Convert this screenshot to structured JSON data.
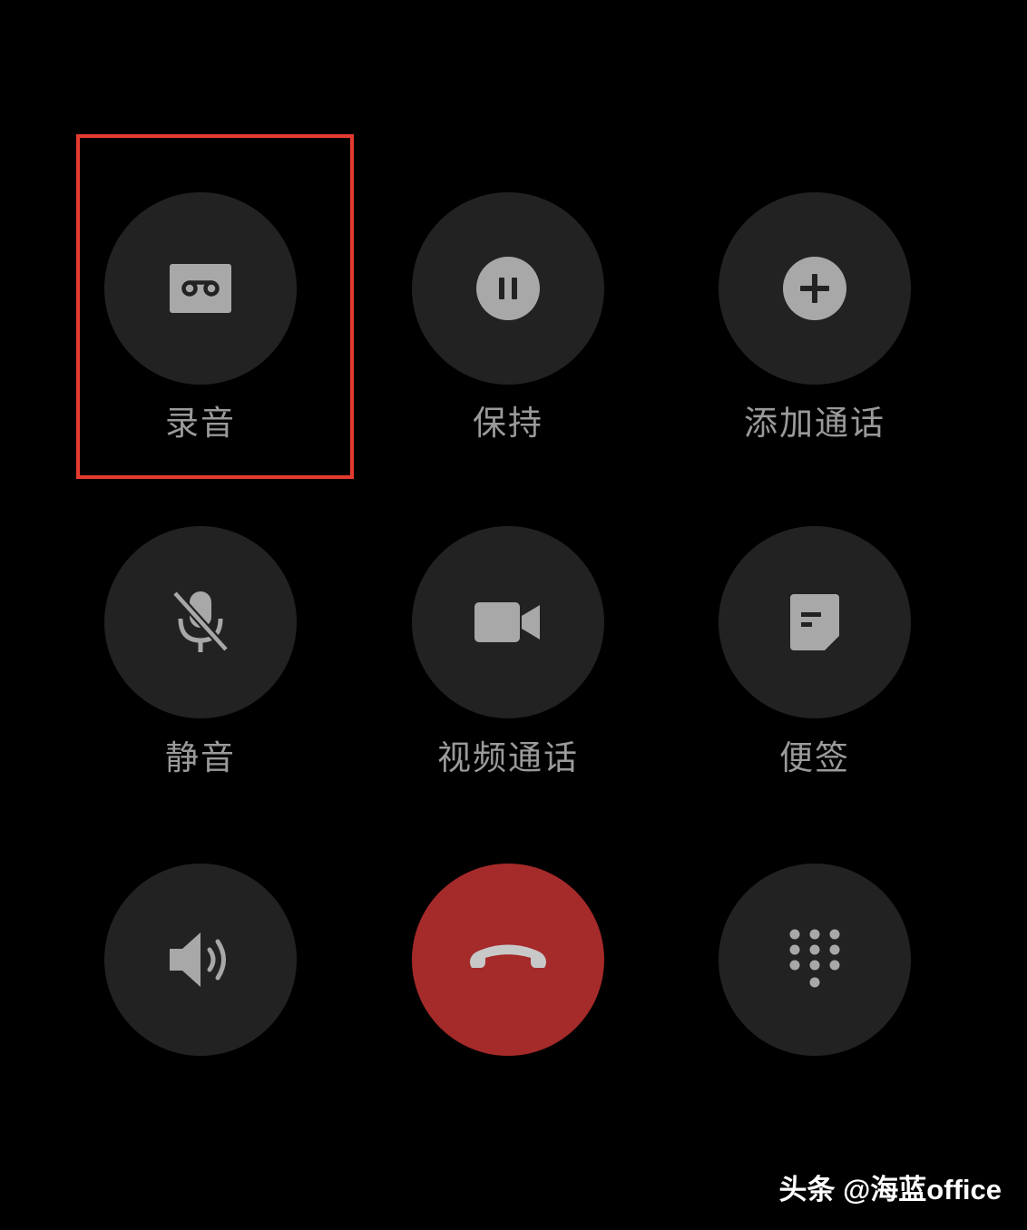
{
  "controls": {
    "record": {
      "label": "录音",
      "icon": "cassette-record-icon"
    },
    "hold": {
      "label": "保持",
      "icon": "pause-icon"
    },
    "add_call": {
      "label": "添加通话",
      "icon": "plus-circle-icon"
    },
    "mute": {
      "label": "静音",
      "icon": "microphone-off-icon"
    },
    "video_call": {
      "label": "视频通话",
      "icon": "video-camera-icon"
    },
    "notes": {
      "label": "便签",
      "icon": "note-icon"
    },
    "speaker": {
      "icon": "speaker-icon"
    },
    "end_call": {
      "icon": "phone-hangup-icon"
    },
    "keypad": {
      "icon": "dialpad-icon"
    }
  },
  "colors": {
    "background": "#000000",
    "button": "#222222",
    "icon": "#a8a8a8",
    "end_call": "#a52a2a",
    "highlight": "#e53b2f"
  },
  "watermark": {
    "text": "头条 @海蓝office"
  }
}
